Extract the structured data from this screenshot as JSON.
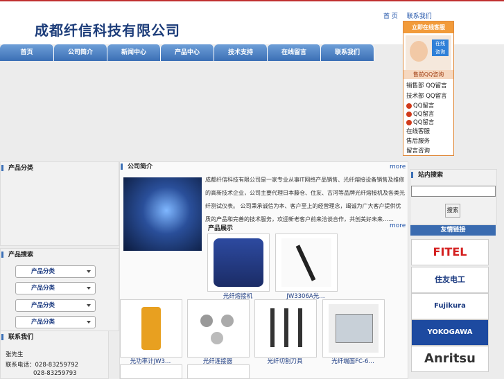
{
  "header": {
    "company_name": "成都纤信科技有限公司",
    "home_link": "首 页",
    "contact_link": "联系我们"
  },
  "nav": {
    "items": [
      "首页",
      "公司简介",
      "新闻中心",
      "产品中心",
      "技术支持",
      "在线留言",
      "联系我们"
    ]
  },
  "panels": {
    "left_top_title": "产品分类",
    "left_mid_title": "产品搜索",
    "left_bottom_title": "联系我们",
    "intro_title": "公司简介",
    "intro_more": "more",
    "product_title": "产品展示",
    "product_more": "more",
    "search_title": "站内搜索",
    "links_title": "友情链接"
  },
  "intro_text": "成都纤信科技有限公司是一家专业从事IT网络产品销售、光纤熔接设备销售及维修的高新技术企业，公司主要代理日本藤仓、住友、古河等品牌光纤熔接机及各类光纤测试仪表。 公司秉承诚信为本、客户至上的经营理念，竭诚为广大客户提供优质的产品和完善的技术服务，欢迎新老客户前来洽谈合作，共创美好未来……",
  "dropdowns": [
    "产品分类",
    "产品分类",
    "产品分类",
    "产品分类"
  ],
  "products": [
    {
      "label": "光纤熔接机"
    },
    {
      "label": "JW3306A光…"
    },
    {
      "label": "光功率计JW3…"
    },
    {
      "label": "光纤连接器"
    },
    {
      "label": "光纤切割刀具"
    },
    {
      "label": "光纤端面FC-6…"
    }
  ],
  "contact": {
    "name": "张先生",
    "phone1": "028-83259792",
    "phone2": "028-83259793",
    "phone_label": "联系电话："
  },
  "customer_service": {
    "head": "立即在线客服",
    "sub": "售前QQ咨询",
    "rows": [
      "销售部 QQ留言",
      "技术部 QQ留言",
      "QQ留言",
      "QQ留言",
      "QQ留言",
      "在线客服",
      "售后服务",
      "留言咨询"
    ]
  },
  "search": {
    "button": "搜索"
  },
  "brands": [
    {
      "name": "FITEL",
      "color": "#d42020"
    },
    {
      "name": "住友电工",
      "color": "#1b3a80"
    },
    {
      "name": "Fujikura",
      "color": "#1b3a80"
    },
    {
      "name": "YOKOGAWA",
      "color": "#ffffff"
    },
    {
      "name": "Anritsu",
      "color": "#333333"
    }
  ]
}
